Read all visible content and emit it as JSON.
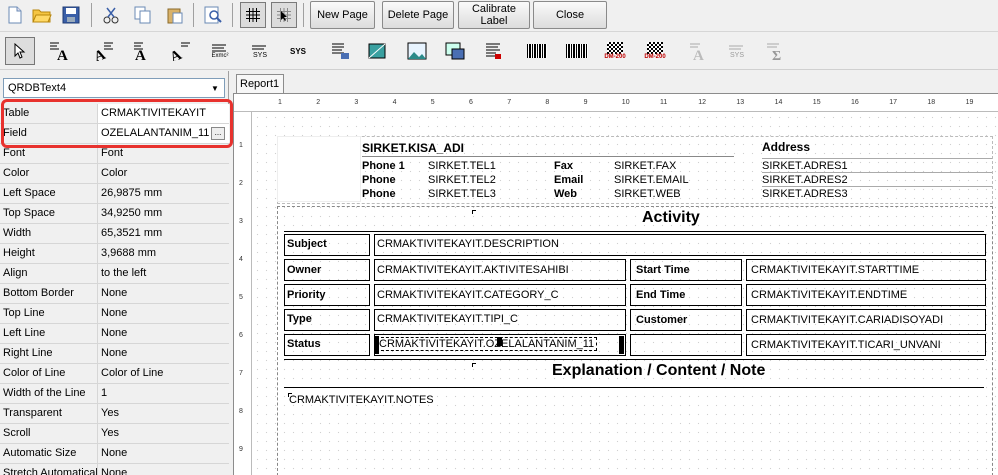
{
  "toolbar": {
    "new_page": "New Page",
    "delete_page": "Delete Page",
    "calibrate_label_1": "Calibrate",
    "calibrate_label_2": "Label",
    "close": "Close"
  },
  "toolbar2": {
    "sys1": "SYS",
    "sys2": "SYS",
    "dm1": "DM-200",
    "dm2": "DM-200",
    "sys3": "SYS",
    "expr": "Exmc²"
  },
  "component_select": "QRDBText4",
  "properties": [
    {
      "name": "Table",
      "value": "CRMAKTIVITEKAYIT"
    },
    {
      "name": "Field",
      "value": "OZELALANTANIM_11"
    },
    {
      "name": "Font",
      "value": "Font"
    },
    {
      "name": "Color",
      "value": "Color"
    },
    {
      "name": "Left Space",
      "value": "26,9875 mm"
    },
    {
      "name": "Top Space",
      "value": "34,9250 mm"
    },
    {
      "name": "Width",
      "value": "65,3521 mm"
    },
    {
      "name": "Height",
      "value": "3,9688 mm"
    },
    {
      "name": "Align",
      "value": "to the left"
    },
    {
      "name": "Bottom Border",
      "value": "None"
    },
    {
      "name": "Top Line",
      "value": "None"
    },
    {
      "name": "Left Line",
      "value": "None"
    },
    {
      "name": "Right Line",
      "value": "None"
    },
    {
      "name": "Color of Line",
      "value": "Color of Line"
    },
    {
      "name": "Width of the Line",
      "value": "1"
    },
    {
      "name": "Transparent",
      "value": "Yes"
    },
    {
      "name": "Scroll",
      "value": "Yes"
    },
    {
      "name": "Automatic Size",
      "value": "None"
    },
    {
      "name": "Stretch Automatical",
      "value": "None"
    }
  ],
  "report_tab": "Report1",
  "ruler_h": [
    "1",
    "2",
    "3",
    "4",
    "5",
    "6",
    "7",
    "8",
    "9",
    "10",
    "11",
    "12",
    "13",
    "14",
    "15",
    "16",
    "17",
    "18",
    "19",
    "2"
  ],
  "ruler_v": [
    "1",
    "2",
    "3",
    "4",
    "5",
    "6",
    "7",
    "8",
    "9"
  ],
  "report": {
    "company": "SIRKET.KISA_ADI",
    "address_label": "Address",
    "phone1_label": "Phone 1",
    "phone_label_2": "Phone",
    "phone_label_3": "Phone",
    "tel1": "SIRKET.TEL1",
    "tel2": "SIRKET.TEL2",
    "tel3": "SIRKET.TEL3",
    "fax_label": "Fax",
    "email_label": "Email",
    "web_label": "Web",
    "fax": "SIRKET.FAX",
    "email": "SIRKET.EMAIL",
    "web": "SIRKET.WEB",
    "adres1": "SIRKET.ADRES1",
    "adres2": "SIRKET.ADRES2",
    "adres3": "SIRKET.ADRES3",
    "activity_title": "Activity",
    "subject_label": "Subject",
    "owner_label": "Owner",
    "priority_label": "Priority",
    "type_label": "Type",
    "status_label": "Status",
    "description": "CRMAKTIVITEKAYIT.DESCRIPTION",
    "owner": "CRMAKTIVITEKAYIT.AKTIVITESAHIBI",
    "category": "CRMAKTIVITEKAYIT.CATEGORY_C",
    "type": "CRMAKTIVITEKAYIT.TIPI_C",
    "status": "CRMAKTIVITEKAYIT.OZELALANTANIM_11",
    "start_label": "Start Time",
    "end_label": "End Time",
    "customer_label": "Customer",
    "start": "CRMAKTIVITEKAYIT.STARTTIME",
    "end": "CRMAKTIVITEKAYIT.ENDTIME",
    "customer": "CRMAKTIVITEKAYIT.CARIADISOYADI",
    "ticari": "CRMAKTIVITEKAYIT.TICARI_UNVANI",
    "explanation_title": "Explanation / Content / Note",
    "notes": "CRMAKTIVITEKAYIT.NOTES"
  }
}
